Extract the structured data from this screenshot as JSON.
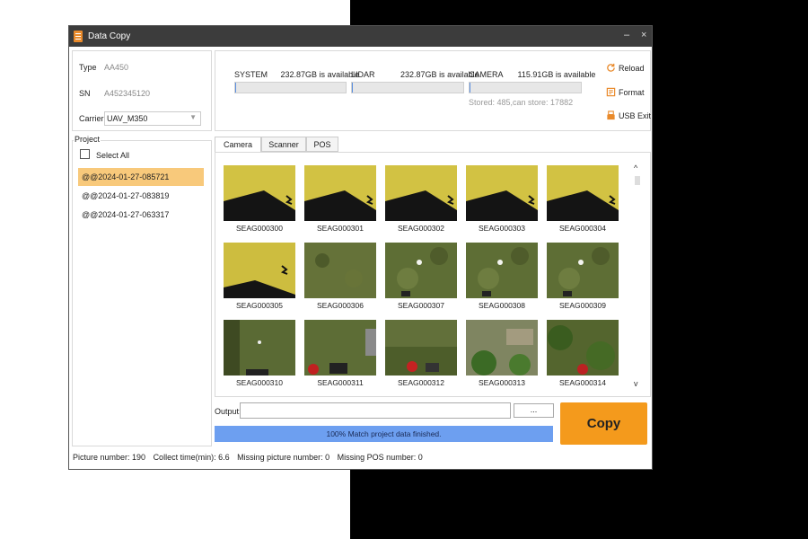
{
  "window": {
    "title": "Data Copy",
    "minimize": "–",
    "close": "×"
  },
  "device": {
    "type_label": "Type",
    "type_value": "AA450",
    "sn_label": "SN",
    "sn_value": "A452345120",
    "carrier_label": "Carrier",
    "carrier_value": "UAV_M350"
  },
  "storage": [
    {
      "name": "SYSTEM",
      "available": "232.87GB is available",
      "fill": 0.01
    },
    {
      "name": "LIDAR",
      "available": "232.87GB is available",
      "fill": 0.01
    },
    {
      "name": "CAMERA",
      "available": "115.91GB is available",
      "fill": 0.01
    }
  ],
  "storage_note": "Stored: 485,can store: 17882",
  "actions": {
    "reload": "Reload",
    "format": "Format",
    "usb_exit": "USB Exit"
  },
  "project": {
    "label": "Project",
    "select_all": "Select All",
    "items": [
      "@@2024-01-27-085721",
      "@@2024-01-27-083819",
      "@@2024-01-27-063317"
    ],
    "selected_index": 0
  },
  "tabs": [
    "Camera",
    "Scanner",
    "POS"
  ],
  "active_tab": 0,
  "images": [
    {
      "name": "SEAG000300",
      "kind": "yellow"
    },
    {
      "name": "SEAG000301",
      "kind": "yellow"
    },
    {
      "name": "SEAG000302",
      "kind": "yellow"
    },
    {
      "name": "SEAG000303",
      "kind": "yellow"
    },
    {
      "name": "SEAG000304",
      "kind": "yellow"
    },
    {
      "name": "SEAG000305",
      "kind": "yellow2"
    },
    {
      "name": "SEAG000306",
      "kind": "grass"
    },
    {
      "name": "SEAG000307",
      "kind": "grass_marker"
    },
    {
      "name": "SEAG000308",
      "kind": "grass_marker"
    },
    {
      "name": "SEAG000309",
      "kind": "grass_marker"
    },
    {
      "name": "SEAG000310",
      "kind": "garden"
    },
    {
      "name": "SEAG000311",
      "kind": "garden_car"
    },
    {
      "name": "SEAG000312",
      "kind": "garden_red"
    },
    {
      "name": "SEAG000313",
      "kind": "garden_green"
    },
    {
      "name": "SEAG000314",
      "kind": "garden_trees"
    }
  ],
  "scroll": {
    "up": "^",
    "down": "v"
  },
  "output": {
    "label": "Output:",
    "value": "",
    "browse": "..."
  },
  "copy_button": "Copy",
  "progress": {
    "text": "100% Match project data finished.",
    "value": 1.0
  },
  "status": {
    "picture_number": "Picture number: 190",
    "collect_time": "Collect time(min): 6.6",
    "missing_picture": "Missing picture number: 0",
    "missing_pos": "Missing POS number: 0"
  },
  "colors": {
    "accent": "#f49a1c",
    "selection": "#f8c97b",
    "progress": "#6d9ff0",
    "titlebar": "#3c3c3c"
  }
}
